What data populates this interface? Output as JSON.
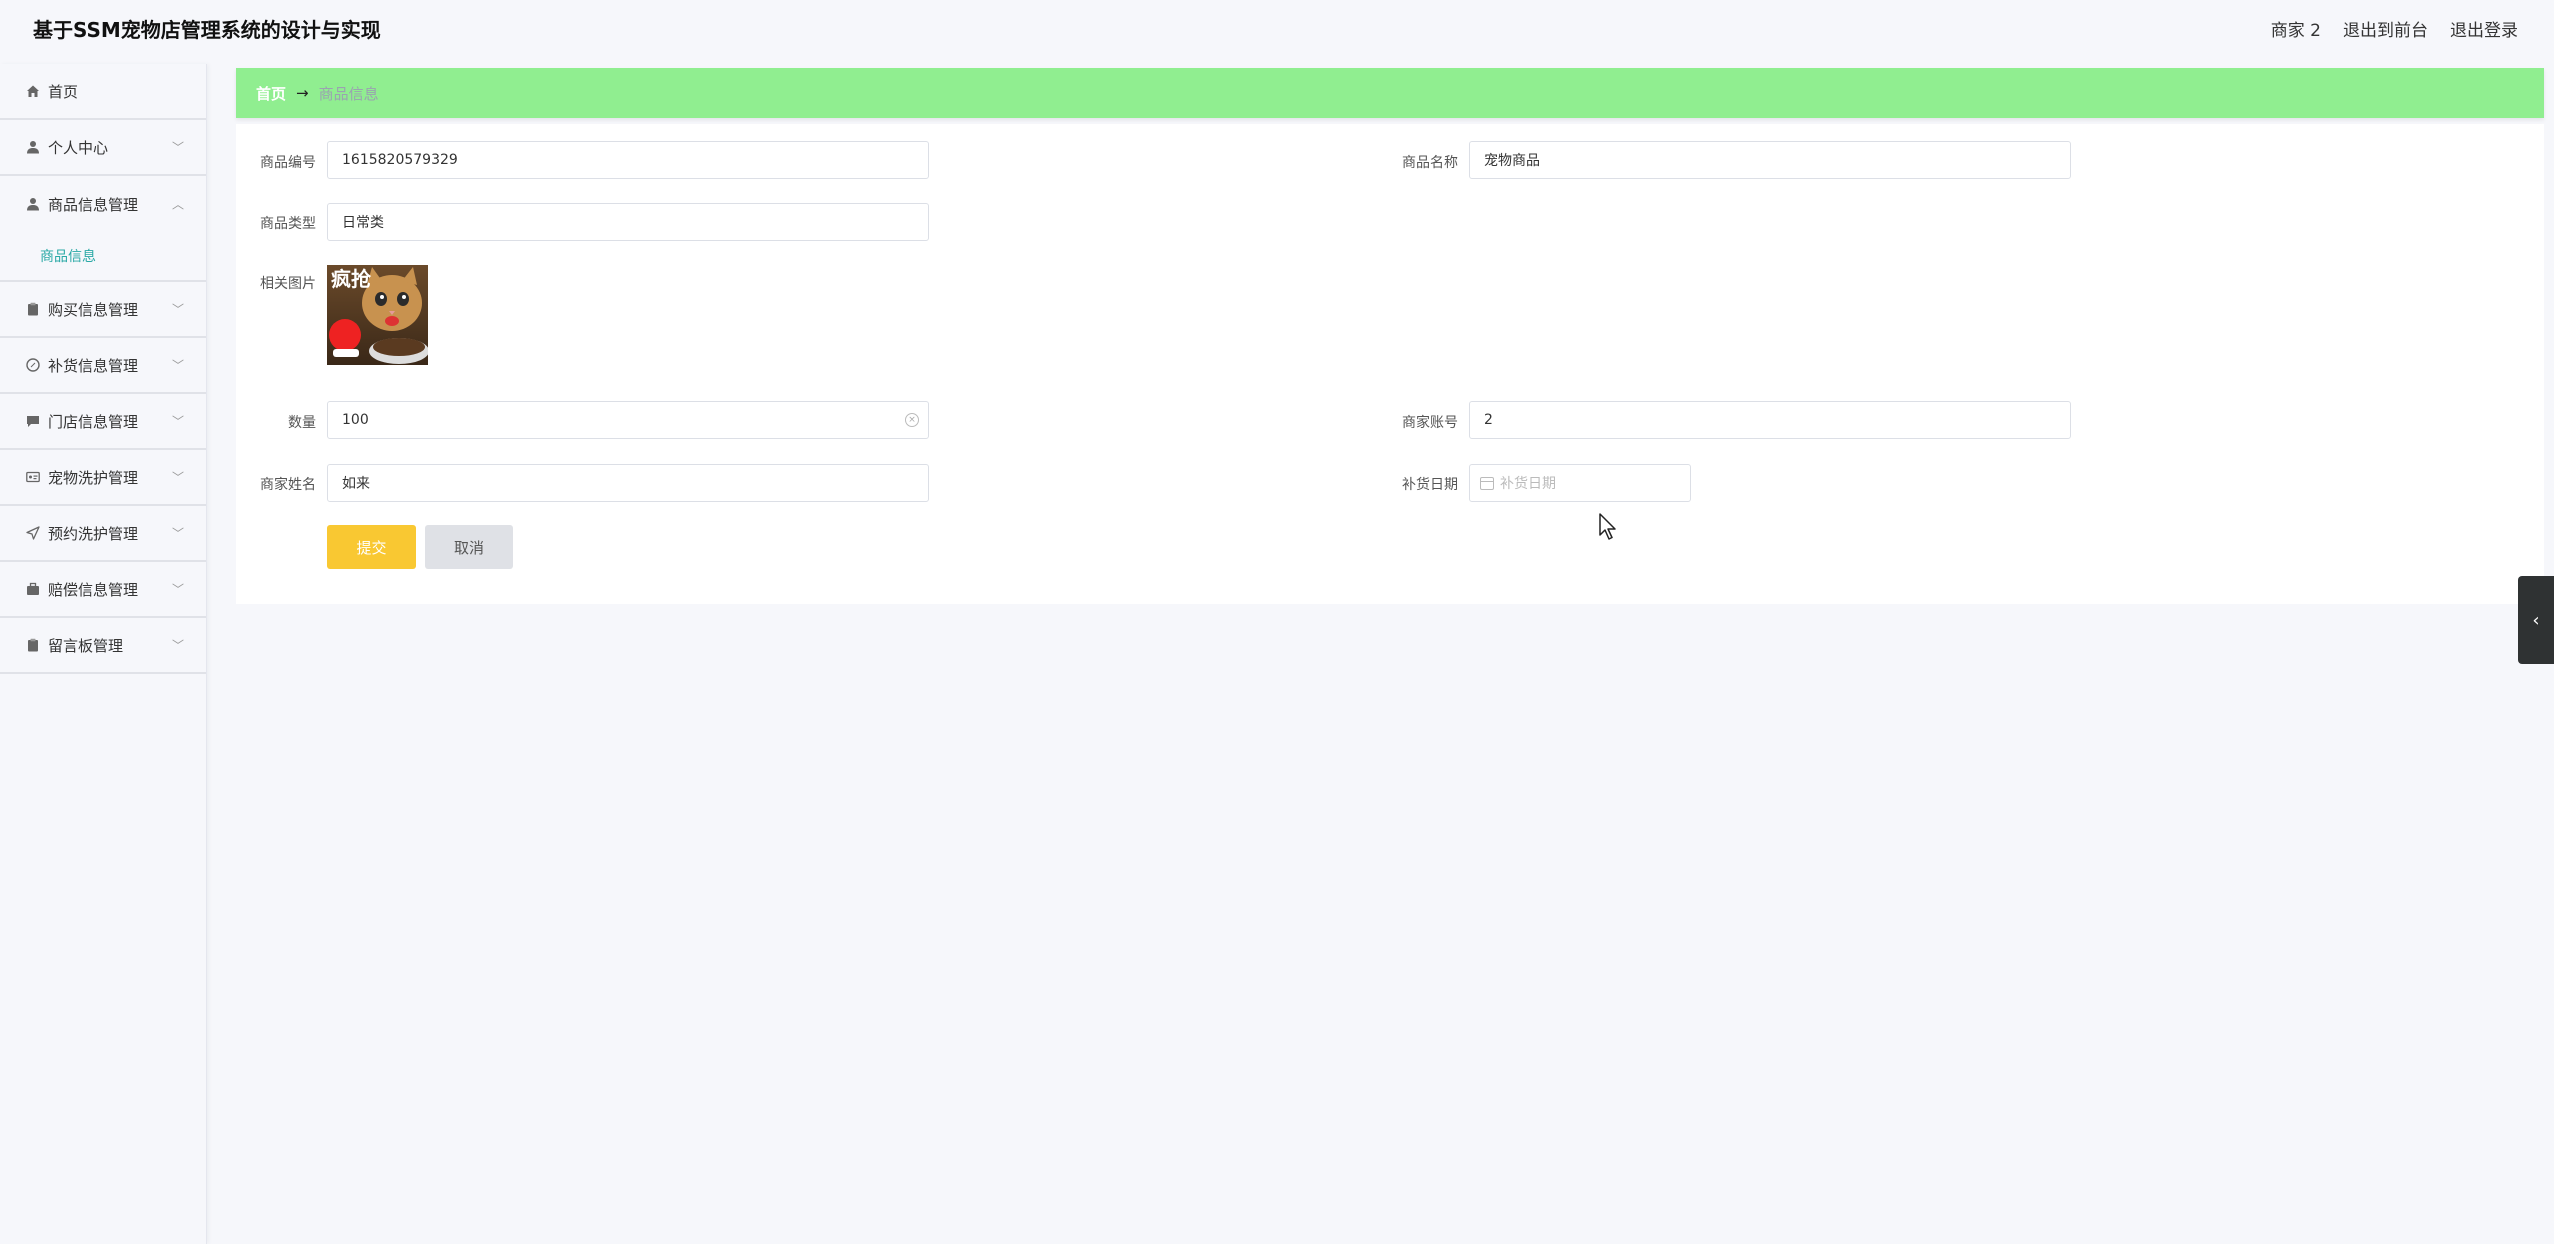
{
  "header": {
    "title": "基于SSM宠物店管理系统的设计与实现",
    "user": "商家 2",
    "to_front": "退出到前台",
    "logout": "退出登录"
  },
  "sidebar": {
    "items": [
      {
        "label": "首页",
        "icon": "home-icon"
      },
      {
        "label": "个人中心",
        "icon": "user-icon"
      },
      {
        "label": "商品信息管理",
        "icon": "user-icon",
        "submenu": "商品信息"
      },
      {
        "label": "购买信息管理",
        "icon": "clipboard-icon"
      },
      {
        "label": "补货信息管理",
        "icon": "compass-icon"
      },
      {
        "label": "门店信息管理",
        "icon": "message-icon"
      },
      {
        "label": "宠物洗护管理",
        "icon": "card-icon"
      },
      {
        "label": "预约洗护管理",
        "icon": "send-icon"
      },
      {
        "label": "赔偿信息管理",
        "icon": "briefcase-icon"
      },
      {
        "label": "留言板管理",
        "icon": "clipboard-icon"
      }
    ]
  },
  "breadcrumb": {
    "home": "首页",
    "separator": "→",
    "current": "商品信息"
  },
  "form": {
    "product_no": {
      "label": "商品编号",
      "value": "1615820579329"
    },
    "product_name": {
      "label": "商品名称",
      "value": "宠物商品"
    },
    "product_type": {
      "label": "商品类型",
      "value": "日常类"
    },
    "image": {
      "label": "相关图片",
      "caption": "疯抢"
    },
    "quantity": {
      "label": "数量",
      "value": "100"
    },
    "merchant_account": {
      "label": "商家账号",
      "value": "2"
    },
    "merchant_name": {
      "label": "商家姓名",
      "value": "如来"
    },
    "restock_date": {
      "label": "补货日期",
      "placeholder": "补货日期"
    },
    "submit": "提交",
    "cancel": "取消"
  },
  "colors": {
    "breadcrumb_bg": "#90ee90",
    "submit_bg": "#f9c832",
    "cancel_bg": "#dfe1e6",
    "active_submenu": "#2aa9a6"
  }
}
